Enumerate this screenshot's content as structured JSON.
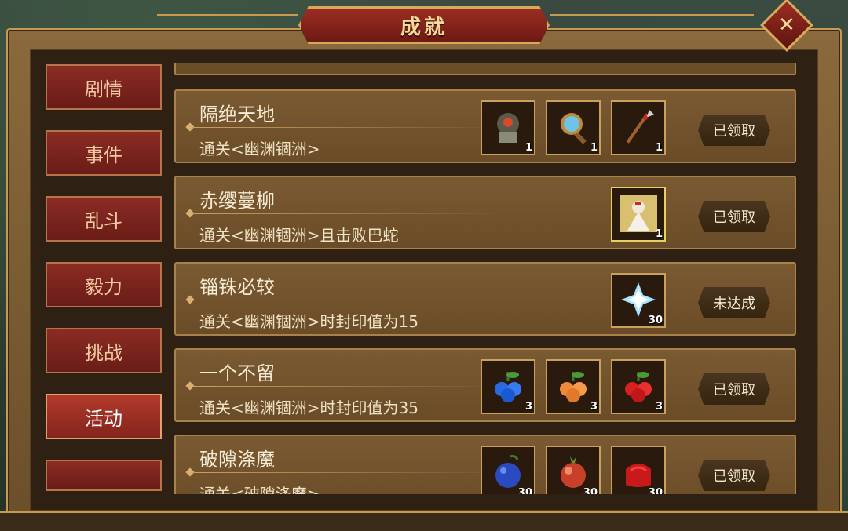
{
  "window": {
    "title": "成就",
    "close_icon": "close-icon"
  },
  "tabs": [
    {
      "label": "剧情",
      "active": false
    },
    {
      "label": "事件",
      "active": false
    },
    {
      "label": "乱斗",
      "active": false
    },
    {
      "label": "毅力",
      "active": false
    },
    {
      "label": "挑战",
      "active": false
    },
    {
      "label": "活动",
      "active": true
    }
  ],
  "achievements": [
    {
      "title": "隔绝天地",
      "desc": "通关<幽渊锢洲>",
      "rewards": [
        {
          "icon": "armored-monster-icon",
          "qty": "1"
        },
        {
          "icon": "magnifier-mirror-icon",
          "qty": "1"
        },
        {
          "icon": "spear-icon",
          "qty": "1"
        }
      ],
      "status": "已领取"
    },
    {
      "title": "赤缨蔓柳",
      "desc": "通关<幽渊锢洲>且击败巴蛇",
      "rewards": [
        {
          "icon": "hero-portrait-icon",
          "qty": "1"
        }
      ],
      "status": "已领取"
    },
    {
      "title": "锱铢必较",
      "desc": "通关<幽渊锢洲>时封印值为15",
      "rewards": [
        {
          "icon": "ice-crystal-icon",
          "qty": "30"
        }
      ],
      "status": "未达成"
    },
    {
      "title": "一个不留",
      "desc": "通关<幽渊锢洲>时封印值为35",
      "rewards": [
        {
          "icon": "blue-fruit-icon",
          "qty": "3"
        },
        {
          "icon": "orange-fruit-icon",
          "qty": "3"
        },
        {
          "icon": "red-fruit-icon",
          "qty": "3"
        }
      ],
      "status": "已领取"
    },
    {
      "title": "破隙涤魔",
      "desc": "通关<破隙涤魔>",
      "rewards": [
        {
          "icon": "blue-gourd-icon",
          "qty": "30"
        },
        {
          "icon": "red-pomegranate-icon",
          "qty": "30"
        },
        {
          "icon": "red-cloth-icon",
          "qty": "30"
        }
      ],
      "status": "已领取"
    }
  ],
  "colors": {
    "accent": "#c79a52",
    "tab_red": "#8a2c24",
    "panel_brown": "#7a5a32"
  }
}
